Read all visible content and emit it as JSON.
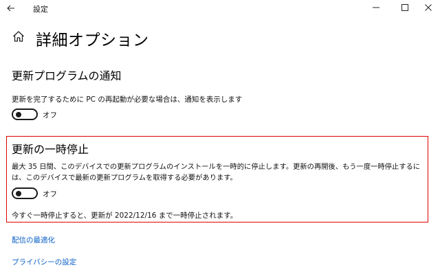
{
  "window": {
    "title": "設定",
    "back_icon": "back-arrow-icon",
    "controls": [
      "minimize-icon",
      "maximize-icon",
      "close-icon"
    ]
  },
  "header": {
    "home_icon": "home-icon",
    "title": "詳細オプション"
  },
  "notifications": {
    "heading": "更新プログラムの通知",
    "description": "更新を完了するために PC の再起動が必要な場合は、通知を表示します",
    "toggle": {
      "state": "off",
      "label": "オフ"
    }
  },
  "pause": {
    "heading": "更新の一時停止",
    "description": "最大 35 日間、このデバイスでの更新プログラムのインストールを一時的に停止します。更新の再開後、もう一度一時停止するには、このデバイスで最新の更新プログラムを取得する必要があります。",
    "toggle": {
      "state": "off",
      "label": "オフ"
    },
    "until_text": "今すぐ一時停止すると、更新が 2022/12/16 まで一時停止されます。",
    "highlight_color": "#e00000"
  },
  "links": {
    "delivery_optimization": "配信の最適化",
    "privacy_settings": "プライバシーの設定",
    "color": "#0a60c6"
  }
}
